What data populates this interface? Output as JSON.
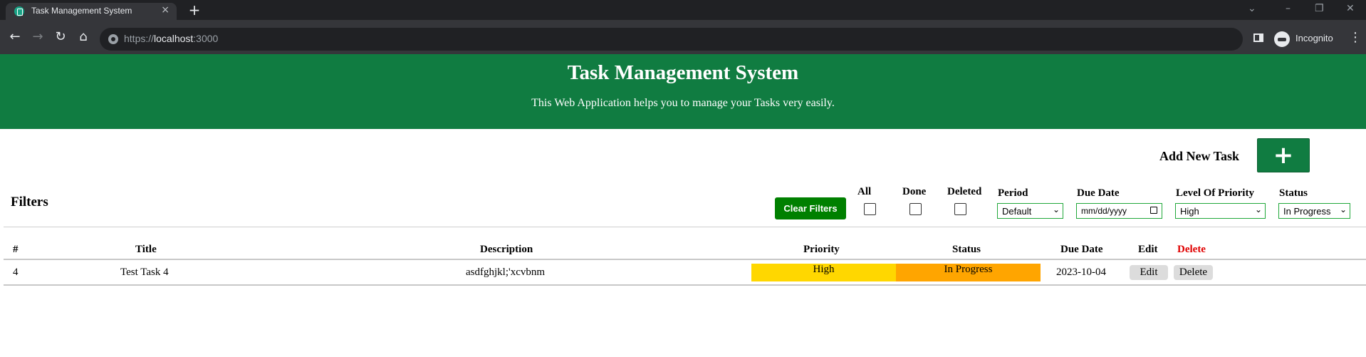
{
  "browser": {
    "tab_title": "Task Management System",
    "tab_close": "×",
    "new_tab": "+",
    "url_scheme": "https://",
    "url_host": "localhost",
    "url_port": ":3000",
    "incognito_label": "Incognito"
  },
  "header": {
    "title": "Task Management System",
    "subtitle": "This Web Application helps you to manage your Tasks very easily.",
    "color": "#107c41"
  },
  "add_task": {
    "label": "Add New Task",
    "button": "+"
  },
  "filters": {
    "title": "Filters",
    "clear_button": "Clear Filters",
    "all_label": "All",
    "done_label": "Done",
    "deleted_label": "Deleted",
    "period_label": "Period",
    "period_value": "Default",
    "due_date_label": "Due Date",
    "due_date_placeholder": "mm/dd/yyyy",
    "priority_label": "Level Of Priority",
    "priority_value": "High",
    "status_label": "Status",
    "status_value": "In Progress"
  },
  "table": {
    "headers": {
      "num": "#",
      "title": "Title",
      "description": "Description",
      "priority": "Priority",
      "status": "Status",
      "due_date": "Due Date",
      "edit": "Edit",
      "delete": "Delete"
    },
    "rows": [
      {
        "num": "4",
        "title": "Test Task 4",
        "description": "asdfghjkl;'xcvbnm",
        "priority": "High",
        "status": "In Progress",
        "due_date": "2023-10-04",
        "edit": "Edit",
        "delete": "Delete"
      }
    ]
  },
  "colors": {
    "priority_high": "#ffd700",
    "status_in_progress": "#ffa500",
    "delete_header": "#e00000"
  }
}
